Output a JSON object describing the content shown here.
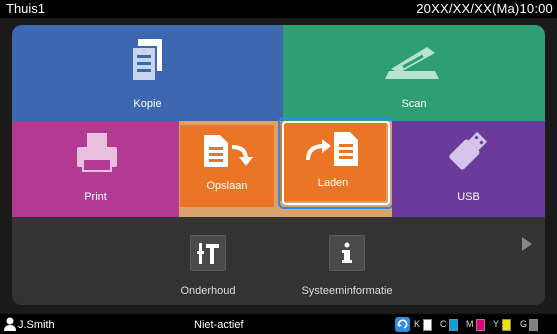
{
  "header": {
    "title": "Thuis1",
    "datetime": "20XX/XX/XX(Ma)10:00"
  },
  "tiles": {
    "kopie": {
      "label": "Kopie",
      "icon": "copy-document-icon"
    },
    "scan": {
      "label": "Scan",
      "icon": "scanner-icon"
    },
    "print": {
      "label": "Print",
      "icon": "printer-icon"
    },
    "opslaan": {
      "label": "Opslaan",
      "icon": "save-document-icon"
    },
    "laden": {
      "label": "Laden",
      "icon": "load-document-icon",
      "selected": true
    },
    "usb": {
      "label": "USB",
      "icon": "usb-icon"
    }
  },
  "bottom": {
    "onderhoud": {
      "label": "Onderhoud",
      "icon": "tools-icon"
    },
    "systeeminformatie": {
      "label": "Systeeminformatie",
      "icon": "info-icon"
    },
    "next_icon": "next-page-arrow-icon"
  },
  "status": {
    "user": "J.Smith",
    "state": "Niet-actief",
    "inks": [
      {
        "label": "K",
        "color": "#000000"
      },
      {
        "label": "C",
        "color": "#00a0e0"
      },
      {
        "label": "M",
        "color": "#e0007a"
      },
      {
        "label": "Y",
        "color": "#f5e100"
      },
      {
        "label": "G",
        "color": "#808080"
      }
    ]
  },
  "colors": {
    "kopie": "#3d67ae",
    "scan": "#2e9e73",
    "print": "#b23a92",
    "usb": "#6a3b9a",
    "opslaan": "#ea7524",
    "laden": "#ea7524",
    "selection": "#2f8ce6"
  }
}
